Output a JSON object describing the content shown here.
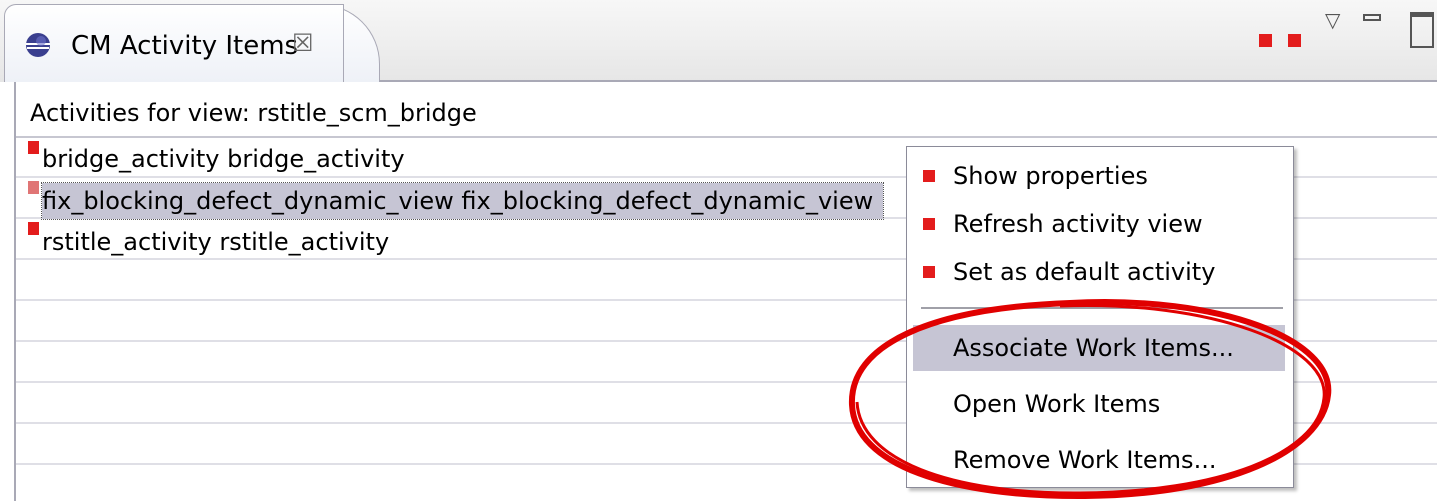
{
  "tab": {
    "title": "CM Activity Items",
    "close_glyph": "☒"
  },
  "toolbar": {
    "view_menu_glyph": "▽"
  },
  "header": {
    "text": "Activities for view: rstitle_scm_bridge"
  },
  "rows": [
    {
      "name": "bridge_activity",
      "label": "bridge_activity",
      "selected": false
    },
    {
      "name": "fix_blocking_defect_dynamic_view",
      "label": "fix_blocking_defect_dynamic_view",
      "selected": true
    },
    {
      "name": "rstitle_activity",
      "label": "rstitle_activity",
      "selected": false
    }
  ],
  "row_texts": [
    "bridge_activity   bridge_activity",
    "fix_blocking_defect_dynamic_view   fix_blocking_defect_dynamic_view",
    "rstitle_activity   rstitle_activity"
  ],
  "context_menu": {
    "items": [
      {
        "label": "Show properties",
        "icon": "red-square-icon"
      },
      {
        "label": "Refresh activity view",
        "icon": "red-square-icon"
      },
      {
        "label": "Set as default activity",
        "icon": "red-square-icon"
      },
      {
        "label": "Associate Work Items...",
        "highlighted": true
      },
      {
        "label": "Open Work Items"
      },
      {
        "label": "Remove Work Items..."
      }
    ]
  },
  "colors": {
    "accent_red": "#e31c1c",
    "selection": "#c6c5d4",
    "annotation_circle": "#e00000"
  }
}
